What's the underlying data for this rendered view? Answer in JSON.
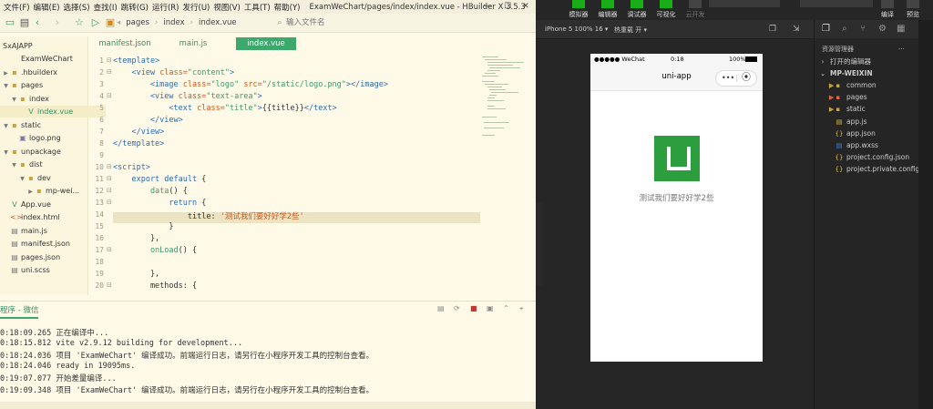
{
  "hbuilder": {
    "menu": [
      "文件(F)",
      "编辑(E)",
      "选择(S)",
      "查找(I)",
      "跳转(G)",
      "运行(R)",
      "发行(U)",
      "视图(V)",
      "工具(T)",
      "帮助(Y)"
    ],
    "window_title": "ExamWeChart/pages/index/index.vue - HBuilder X 3.5.3",
    "breadcrumb": [
      "pages",
      "index",
      "index.vue"
    ],
    "search_placeholder": "输入文件名",
    "project_label": "SxAJAPP",
    "tree": [
      {
        "label": "ExamWeChart",
        "type": "project",
        "level": 0
      },
      {
        "label": ".hbuilderx",
        "type": "folder",
        "level": 0
      },
      {
        "label": "pages",
        "type": "folder-open",
        "level": 0
      },
      {
        "label": "index",
        "type": "folder-open",
        "level": 1
      },
      {
        "label": "index.vue",
        "type": "vue",
        "level": 2,
        "selected": true
      },
      {
        "label": "static",
        "type": "folder-open",
        "level": 0
      },
      {
        "label": "logo.png",
        "type": "image",
        "level": 1
      },
      {
        "label": "unpackage",
        "type": "folder-open",
        "level": 0
      },
      {
        "label": "dist",
        "type": "folder-open",
        "level": 1
      },
      {
        "label": "dev",
        "type": "folder-open",
        "level": 2
      },
      {
        "label": "mp-wei...",
        "type": "folder",
        "level": 3
      },
      {
        "label": "App.vue",
        "type": "vue",
        "level": 0
      },
      {
        "label": "index.html",
        "type": "html",
        "level": 0
      },
      {
        "label": "main.js",
        "type": "js",
        "level": 0
      },
      {
        "label": "manifest.json",
        "type": "json",
        "level": 0
      },
      {
        "label": "pages.json",
        "type": "json",
        "level": 0
      },
      {
        "label": "uni.scss",
        "type": "scss",
        "level": 0
      }
    ],
    "tabs": [
      {
        "label": "manifest.json",
        "active": false
      },
      {
        "label": "main.js",
        "active": false
      },
      {
        "label": "index.vue",
        "active": true
      }
    ],
    "code_lines": [
      {
        "n": "1",
        "fold": "⊟",
        "segs": [
          [
            "kw",
            "<template>"
          ]
        ]
      },
      {
        "n": "2",
        "fold": "⊟",
        "segs": [
          [
            "kw",
            "    <view "
          ],
          [
            "str",
            "class="
          ],
          [
            "txt",
            "\"content\""
          ],
          [
            "kw",
            ">"
          ]
        ]
      },
      {
        "n": "3",
        "fold": "",
        "segs": [
          [
            "kw",
            "        <image "
          ],
          [
            "str",
            "class="
          ],
          [
            "txt",
            "\"logo\" "
          ],
          [
            "str",
            "src="
          ],
          [
            "txt",
            "\"/static/logo.png\""
          ],
          [
            "kw",
            "></image>"
          ]
        ]
      },
      {
        "n": "4",
        "fold": "⊟",
        "segs": [
          [
            "kw",
            "        <view "
          ],
          [
            "str",
            "class="
          ],
          [
            "txt",
            "\"text-area\""
          ],
          [
            "kw",
            ">"
          ]
        ]
      },
      {
        "n": "5",
        "fold": "",
        "segs": [
          [
            "kw",
            "            <text "
          ],
          [
            "str",
            "class="
          ],
          [
            "txt",
            "\"title\""
          ],
          [
            "kw",
            ">"
          ],
          [
            "plain",
            "{{title}}"
          ],
          [
            "kw",
            "</text>"
          ]
        ]
      },
      {
        "n": "6",
        "fold": "",
        "segs": [
          [
            "kw",
            "        </view>"
          ]
        ]
      },
      {
        "n": "7",
        "fold": "",
        "segs": [
          [
            "kw",
            "    </view>"
          ]
        ]
      },
      {
        "n": "8",
        "fold": "",
        "segs": [
          [
            "kw",
            "</template>"
          ]
        ]
      },
      {
        "n": "9",
        "fold": "",
        "segs": []
      },
      {
        "n": "10",
        "fold": "⊟",
        "segs": [
          [
            "kw",
            "<script>"
          ]
        ]
      },
      {
        "n": "11",
        "fold": "⊟",
        "segs": [
          [
            "kw",
            "    export default "
          ],
          [
            "plain",
            "{"
          ]
        ]
      },
      {
        "n": "12",
        "fold": "⊟",
        "segs": [
          [
            "txt",
            "        data"
          ],
          [
            "plain",
            "() {"
          ]
        ]
      },
      {
        "n": "13",
        "fold": "⊟",
        "segs": [
          [
            "kw",
            "            return "
          ],
          [
            "plain",
            "{"
          ]
        ]
      },
      {
        "n": "14",
        "fold": "",
        "segs": [
          [
            "plain",
            "                title: "
          ],
          [
            "str",
            "'测试我们要好好学2些'"
          ]
        ]
      },
      {
        "n": "15",
        "fold": "",
        "segs": [
          [
            "plain",
            "            }"
          ]
        ]
      },
      {
        "n": "16",
        "fold": "",
        "segs": [
          [
            "plain",
            "        },"
          ]
        ]
      },
      {
        "n": "17",
        "fold": "⊟",
        "segs": [
          [
            "txt",
            "        onLoad"
          ],
          [
            "plain",
            "() {"
          ]
        ]
      },
      {
        "n": "18",
        "fold": "",
        "segs": []
      },
      {
        "n": "19",
        "fold": "",
        "segs": [
          [
            "plain",
            "        },"
          ]
        ]
      },
      {
        "n": "20",
        "fold": "⊟",
        "segs": [
          [
            "plain",
            "        methods: {"
          ]
        ]
      }
    ],
    "console_title": "程序 - 微信",
    "console_lines": [
      "0:18:09.265 正在编译中...",
      "0:18:15.812 vite v2.9.12 building for development...",
      "0:18:24.036 项目 'ExamWeChart' 编译成功。前端运行日志，请另行在小程序开发工具的控制台查看。",
      "0:18:24.046 ready in 19095ms.",
      "0:19:07.077 开始差量编译...",
      "0:19:09.348 项目 'ExamWeChart' 编译成功。前端运行日志，请另行在小程序开发工具的控制台查看。"
    ]
  },
  "wechat": {
    "toolbar": [
      {
        "label": "模拟器",
        "dim": false
      },
      {
        "label": "编辑器",
        "dim": false
      },
      {
        "label": "调试器",
        "dim": false
      },
      {
        "label": "可视化",
        "dim": false
      },
      {
        "label": "云开发",
        "dim": true
      }
    ],
    "actions": [
      "编译",
      "预览"
    ],
    "device": "iPhone 5 100% 16 ▾",
    "hot_reload": "热重载 开 ▾",
    "phone": {
      "carrier": "●●●●● WeChat",
      "time": "0:18",
      "battery": "100%",
      "nav_title": "uni-app",
      "capsule_more": "•••",
      "capsule_close": "⦿",
      "text": "测试我们要好好学2些"
    },
    "explorer": {
      "title": "资源管理器",
      "more": "···",
      "open_editors": "打开的编辑器",
      "project": "MP-WEIXIN",
      "items": [
        {
          "label": "common",
          "type": "folder"
        },
        {
          "label": "pages",
          "type": "folder-red"
        },
        {
          "label": "static",
          "type": "folder"
        },
        {
          "label": "app.js",
          "type": "js"
        },
        {
          "label": "app.json",
          "type": "json"
        },
        {
          "label": "app.wxss",
          "type": "wxss"
        },
        {
          "label": "project.config.json",
          "type": "json"
        },
        {
          "label": "project.private.config.j...",
          "type": "json"
        }
      ]
    },
    "colors": {
      "brand_green": "#1aad19",
      "logo_green": "#2c9e3e"
    }
  }
}
